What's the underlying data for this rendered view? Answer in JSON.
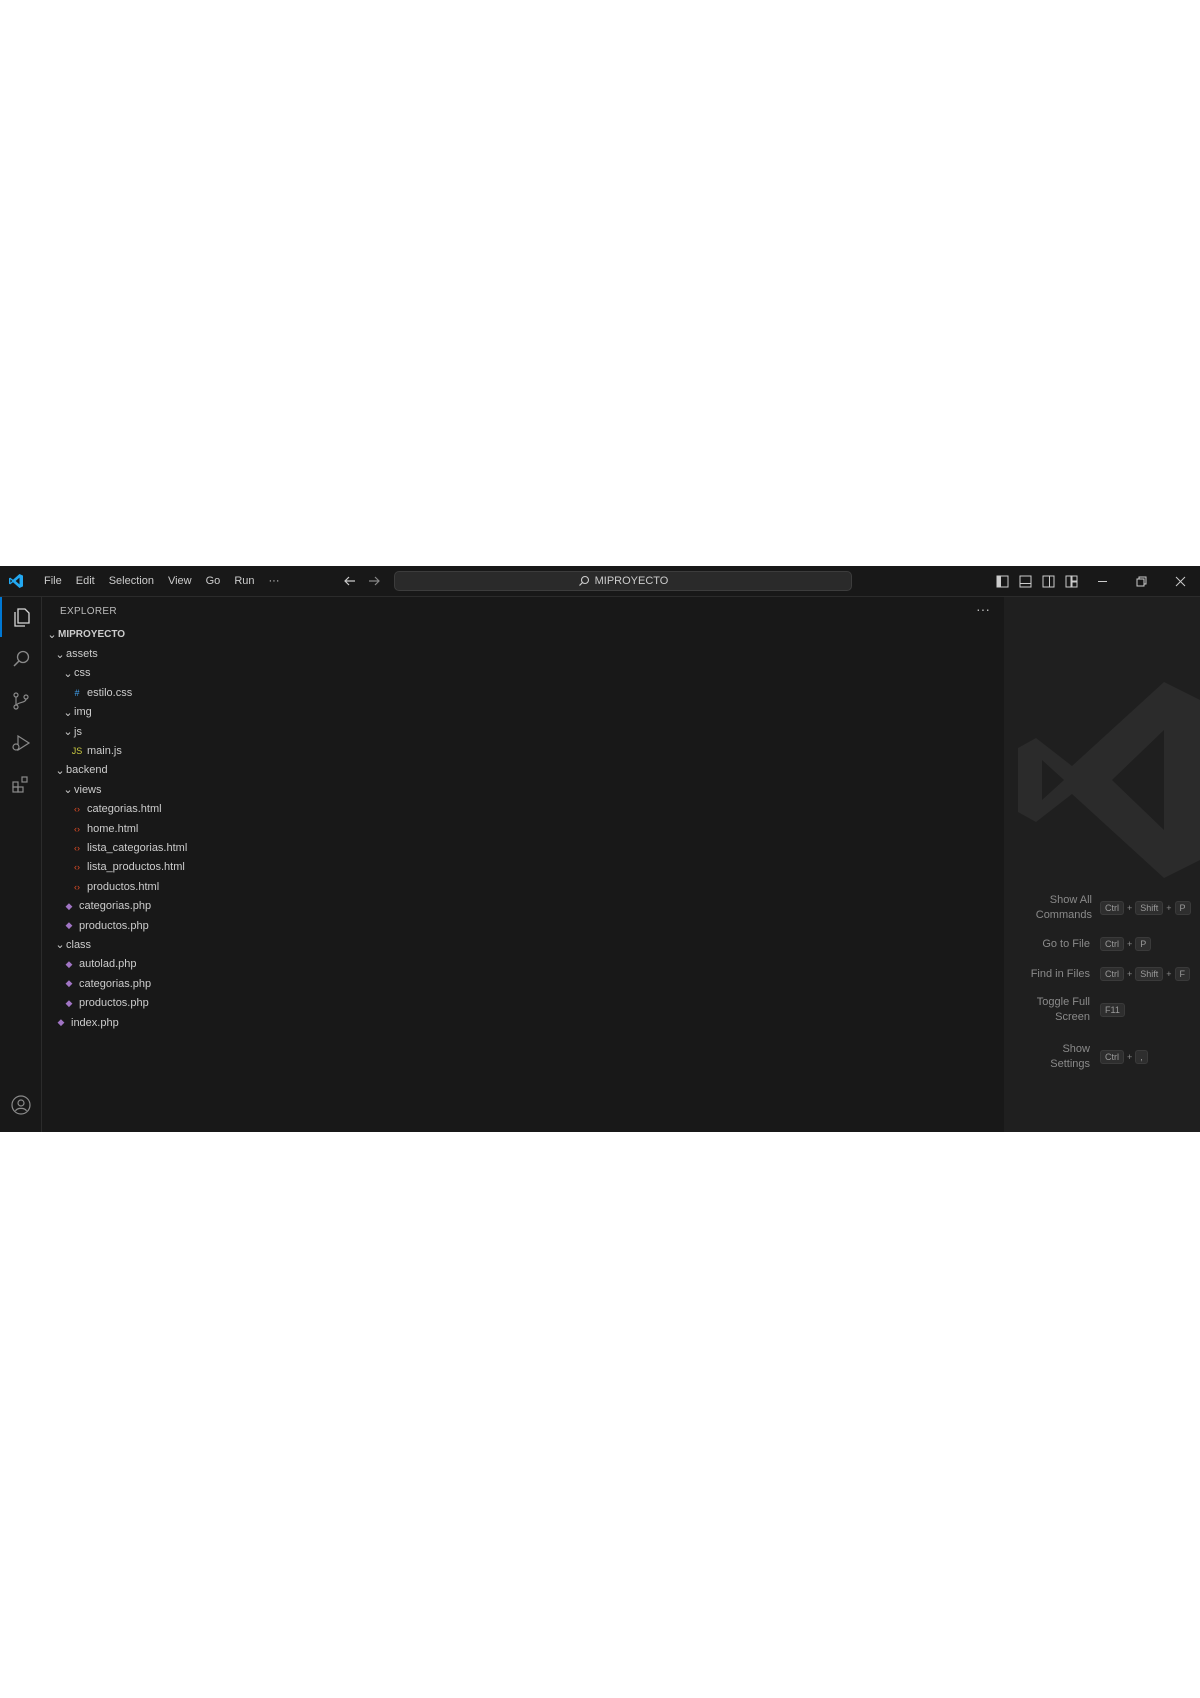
{
  "titlebar": {
    "menu": [
      "File",
      "Edit",
      "Selection",
      "View",
      "Go",
      "Run",
      "···"
    ],
    "search_text": "MIPROYECTO"
  },
  "sidebar": {
    "title": "EXPLORER",
    "more": "···",
    "root": "MIPROYECTO",
    "tree": [
      {
        "label": "assets",
        "depth": 1,
        "kind": "folder"
      },
      {
        "label": "css",
        "depth": 2,
        "kind": "folder"
      },
      {
        "label": "estilo.css",
        "depth": 3,
        "kind": "css"
      },
      {
        "label": "img",
        "depth": 2,
        "kind": "folder"
      },
      {
        "label": "js",
        "depth": 2,
        "kind": "folder"
      },
      {
        "label": "main.js",
        "depth": 3,
        "kind": "js"
      },
      {
        "label": "backend",
        "depth": 1,
        "kind": "folder"
      },
      {
        "label": "views",
        "depth": 2,
        "kind": "folder"
      },
      {
        "label": "categorias.html",
        "depth": 3,
        "kind": "html"
      },
      {
        "label": "home.html",
        "depth": 3,
        "kind": "html"
      },
      {
        "label": "lista_categorias.html",
        "depth": 3,
        "kind": "html"
      },
      {
        "label": "lista_productos.html",
        "depth": 3,
        "kind": "html"
      },
      {
        "label": "productos.html",
        "depth": 3,
        "kind": "html"
      },
      {
        "label": "categorias.php",
        "depth": 2,
        "kind": "php"
      },
      {
        "label": "productos.php",
        "depth": 2,
        "kind": "php"
      },
      {
        "label": "class",
        "depth": 1,
        "kind": "folder"
      },
      {
        "label": "autolad.php",
        "depth": 2,
        "kind": "php"
      },
      {
        "label": "categorias.php",
        "depth": 2,
        "kind": "php"
      },
      {
        "label": "productos.php",
        "depth": 2,
        "kind": "php"
      },
      {
        "label": "index.php",
        "depth": 1,
        "kind": "php"
      }
    ]
  },
  "shortcuts": [
    {
      "label": "Show All Commands",
      "keys": [
        "Ctrl",
        "+",
        "Shift",
        "+",
        "P"
      ]
    },
    {
      "label": "Go to File",
      "keys": [
        "Ctrl",
        "+",
        "P"
      ]
    },
    {
      "label": "Find in Files",
      "keys": [
        "Ctrl",
        "+",
        "Shift",
        "+",
        "F"
      ]
    },
    {
      "label": "Toggle Full Screen",
      "keys": [
        "F11"
      ]
    },
    {
      "label": "Show Settings",
      "keys": [
        "Ctrl",
        "+",
        ","
      ]
    }
  ],
  "colors": {
    "accent": "#0078d4",
    "html_icon": "#e44d26",
    "css_icon": "#42a5f5",
    "js_icon": "#cbcb41",
    "php_icon": "#a074c4"
  },
  "icons": {
    "activity": [
      "explorer-icon",
      "search-icon",
      "source-control-icon",
      "run-debug-icon",
      "extensions-icon",
      "account-icon"
    ]
  }
}
